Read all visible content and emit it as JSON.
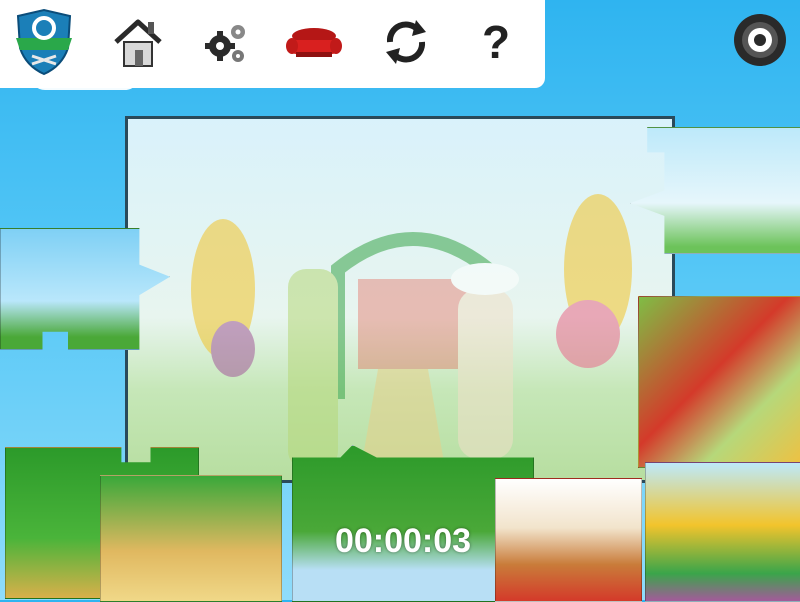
{
  "toolbar": {
    "logo_icon": "crest-logo-icon",
    "buttons": [
      {
        "name": "home-button",
        "icon": "house-icon"
      },
      {
        "name": "settings-button",
        "icon": "gears-icon"
      },
      {
        "name": "sofa-button",
        "icon": "red-sofa-icon"
      },
      {
        "name": "restart-button",
        "icon": "refresh-arrows-icon"
      },
      {
        "name": "help-button",
        "icon": "question-mark-icon"
      }
    ],
    "help_label": "?"
  },
  "corner_settings": {
    "icon": "tire-gear-icon"
  },
  "colors": {
    "sky": "#2fb4f0",
    "grass": "#3da52a",
    "sofa_red": "#d9201f",
    "toolbar_bg": "#ffffff",
    "board_border": "#2a4a5a"
  },
  "timer": {
    "value": "00:00:03"
  }
}
